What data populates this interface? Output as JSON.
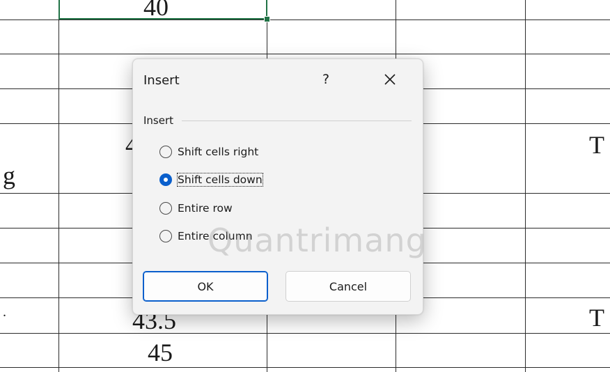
{
  "sheet": {
    "cells": {
      "top_value": "40",
      "row4_partial": "4",
      "row5_left_partial": "g",
      "row4_right_partial": "T",
      "row9_left_partial": ".",
      "row9_value": "43.5",
      "row9_right_partial": "T",
      "row10_value": "45"
    },
    "selection_color": "#217346"
  },
  "dialog": {
    "title": "Insert",
    "help_label": "?",
    "group_label": "Insert",
    "options": [
      {
        "label": "Shift cells right",
        "checked": false
      },
      {
        "label": "Shift cells down",
        "checked": true
      },
      {
        "label": "Entire row",
        "checked": false
      },
      {
        "label": "Entire column",
        "checked": false
      }
    ],
    "ok_label": "OK",
    "cancel_label": "Cancel",
    "accent_color": "#0a5fcc"
  },
  "watermark": "Quantrimang"
}
